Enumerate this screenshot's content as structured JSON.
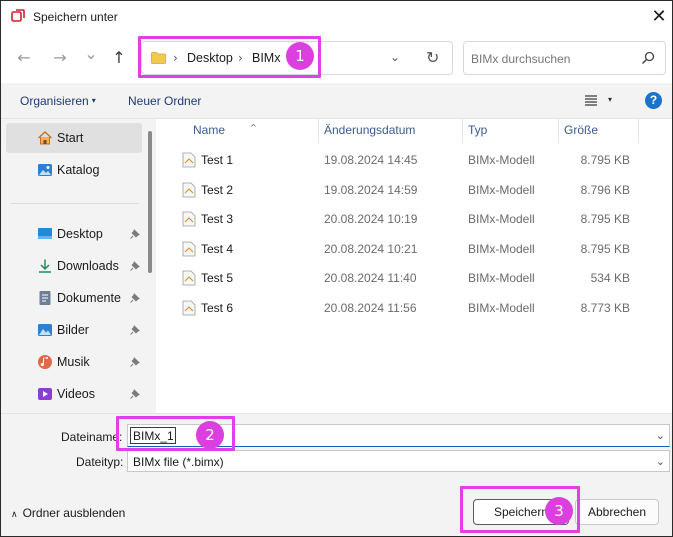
{
  "window": {
    "title": "Speichern unter",
    "close_glyph": "✕",
    "app_icon": "app-icon"
  },
  "navigation": {
    "back_glyph": "←",
    "forward_glyph": "→",
    "recent_glyph": "⌄",
    "up_glyph": "↑",
    "breadcrumb_sep": "›",
    "breadcrumbs": [
      "Desktop",
      "BIMx"
    ],
    "dropdown_glyph": "⌄",
    "refresh_glyph": "↻",
    "search_placeholder": "BIMx durchsuchen"
  },
  "toolbar": {
    "organize_label": "Organisieren",
    "new_folder_label": "Neuer Ordner",
    "caret_glyph": "▾",
    "help_glyph": "?"
  },
  "sidebar": {
    "items": [
      {
        "label": "Start",
        "icon": "home-icon",
        "pinned": false,
        "selected": true
      },
      {
        "label": "Katalog",
        "icon": "gallery-icon",
        "pinned": false,
        "selected": false
      },
      {
        "label": "Desktop",
        "icon": "desktop-icon",
        "pinned": true,
        "selected": false
      },
      {
        "label": "Downloads",
        "icon": "download-icon",
        "pinned": true,
        "selected": false
      },
      {
        "label": "Dokumente",
        "icon": "documents-icon",
        "pinned": true,
        "selected": false
      },
      {
        "label": "Bilder",
        "icon": "pictures-icon",
        "pinned": true,
        "selected": false
      },
      {
        "label": "Musik",
        "icon": "music-icon",
        "pinned": true,
        "selected": false
      },
      {
        "label": "Videos",
        "icon": "videos-icon",
        "pinned": true,
        "selected": false
      }
    ]
  },
  "filelist": {
    "sort_glyph": "^",
    "columns": {
      "name": "Name",
      "date": "Änderungsdatum",
      "type": "Typ",
      "size": "Größe"
    },
    "rows": [
      {
        "name": "Test 1",
        "date": "19.08.2024 14:45",
        "type": "BIMx-Modell",
        "size": "8.795 KB"
      },
      {
        "name": "Test 2",
        "date": "19.08.2024 14:59",
        "type": "BIMx-Modell",
        "size": "8.796 KB"
      },
      {
        "name": "Test 3",
        "date": "20.08.2024 10:19",
        "type": "BIMx-Modell",
        "size": "8.795 KB"
      },
      {
        "name": "Test 4",
        "date": "20.08.2024 10:21",
        "type": "BIMx-Modell",
        "size": "8.795 KB"
      },
      {
        "name": "Test 5",
        "date": "20.08.2024 11:40",
        "type": "BIMx-Modell",
        "size": "534 KB"
      },
      {
        "name": "Test 6",
        "date": "20.08.2024 11:56",
        "type": "BIMx-Modell",
        "size": "8.773 KB"
      }
    ]
  },
  "form": {
    "filename_label": "Dateiname:",
    "filename_value": "BIMx_1",
    "filetype_label": "Dateityp:",
    "filetype_value": "BIMx file (*.bimx)",
    "caret_glyph": "⌄"
  },
  "footer": {
    "hide_folders_glyph": "∧",
    "hide_folders_label": "Ordner ausblenden",
    "save_label": "Speichern",
    "cancel_label": "Abbrechen"
  },
  "annotations": {
    "badges": [
      "1",
      "2",
      "3"
    ],
    "highlight_color": "#e23fe6"
  }
}
